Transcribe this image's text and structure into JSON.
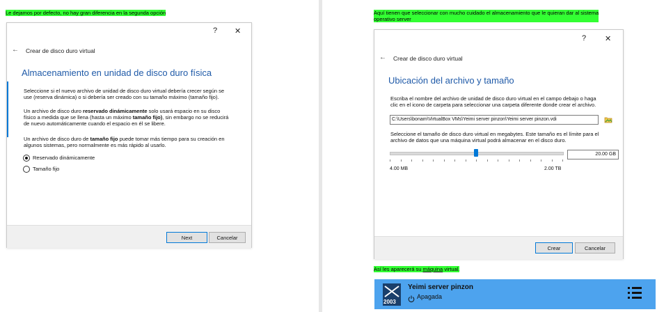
{
  "left": {
    "note": "Le dejamos por defecto, no hay gran diferencia en la segunda opción",
    "help_glyph": "?",
    "close_glyph": "✕",
    "back_glyph": "←",
    "window_title": "Crear de disco duro virtual",
    "heading": "Almacenamiento en unidad de disco duro física",
    "para1_line1": "Seleccione si el nuevo archivo de unidad de disco duro virtual debería crecer según se",
    "para1_line2": "use (reserva dinámica) o si debería ser creado con su tamaño máximo (tamaño fijo).",
    "para2_line1_a": "Un archivo de disco duro ",
    "para2_line1_b": "reservado dinámicamente",
    "para2_line1_c": " solo usará espacio en su disco",
    "para2_line2_a": "físico a medida que se llena (hasta un máximo ",
    "para2_line2_b": "tamaño fijo)",
    "para2_line2_c": ", sin embargo no se reducirá",
    "para2_line3": "de nuevo automáticamente cuando el espacio en él se libere.",
    "para3_line1_a": "Un archivo de disco duro de ",
    "para3_line1_b": "tamaño fijo",
    "para3_line1_c": " puede tomar más tiempo para su creación en",
    "para3_line2": "algunos sistemas, pero normalmente es más rápido al usarlo.",
    "option_dynamic": "Reservado dinámicamente",
    "option_fixed": "Tamaño fijo",
    "next_label": "Next",
    "cancel_label": "Cancelar"
  },
  "right": {
    "note_line1": "Aquí tienen que seleccionar con mucho cuidado el almacenamiento que le quieran dar al sistema",
    "note_line2": "operativo server",
    "help_glyph": "?",
    "close_glyph": "✕",
    "back_glyph": "←",
    "window_title": "Crear de disco duro virtual",
    "heading": "Ubicación del archivo y tamaño",
    "para1_line1": "Escriba el nombre del archivo de unidad de disco duro virtual en el campo debajo o haga",
    "para1_line2": "clic en el icono de carpeta para seleccionar una carpeta diferente donde crear el archivo.",
    "file_path": "C:\\Users\\bonam\\VirtualBox VMs\\Yeimi server pinzon\\Yeimi server pinzon.vdi",
    "para2_line1": "Seleccione el tamaño de disco duro virtual en megabytes. Este tamaño es el límite para el",
    "para2_line2": "archivo de datos que una máquina virtual podrá almacenar en el disco duro.",
    "size_value": "20.00 GB",
    "min_label": "4.00 MB",
    "max_label": "2.00 TB",
    "slider_level": 0.5,
    "create_label": "Crear",
    "cancel_label": "Cancelar",
    "bottom_note_a": "Así les aparecerá su ",
    "bottom_note_b": "máquina",
    "bottom_note_c": " virtual.",
    "vm_name": "Yeimi server pinzon",
    "vm_state": "Apagada",
    "vm_badge": "2003",
    "colors": {
      "accent": "#0078d7",
      "heading": "#1f5aa8",
      "highlight": "#33ff33",
      "vm_bar": "#4da3ee"
    }
  }
}
